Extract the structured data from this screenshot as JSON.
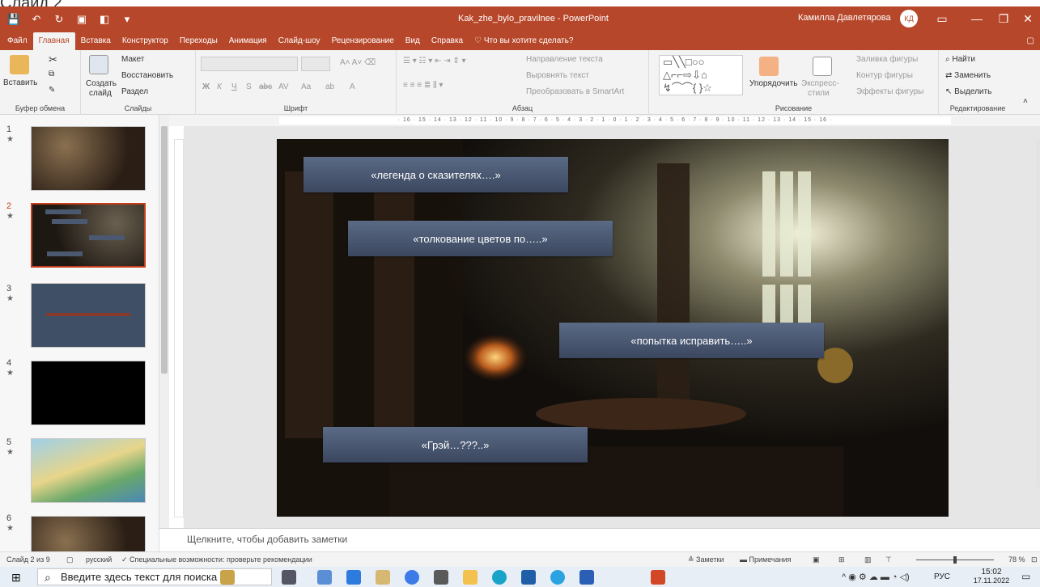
{
  "overlay_heading": "Слайд 2",
  "titlebar": {
    "doc_title": "Kak_zhe_bylo_pravilnee  -  PowerPoint",
    "user_name": "Камилла Давлетярова",
    "user_initials": "КД"
  },
  "tabs": [
    "Файл",
    "Главная",
    "Вставка",
    "Конструктор",
    "Переходы",
    "Анимация",
    "Слайд-шоу",
    "Рецензирование",
    "Вид",
    "Справка"
  ],
  "tell_me": "Что вы хотите сделать?",
  "ribbon": {
    "clipboard": {
      "paste": "Вставить",
      "label": "Буфер обмена"
    },
    "slides": {
      "layout": "Макет",
      "reset": "Восстановить",
      "new_slide_1": "Создать",
      "new_slide_2": "слайд",
      "section": "Раздел",
      "label": "Слайды"
    },
    "font": {
      "label": "Шрифт",
      "bold": "Ж",
      "italic": "К",
      "underline": "Ч",
      "shadow": "S",
      "strike": "abc",
      "spacing": "AV",
      "case": "Aa",
      "color": "A"
    },
    "paragraph": {
      "text_direction": "Направление текста",
      "align_text": "Выровнять текст",
      "smartart": "Преобразовать в SmartArt",
      "label": "Абзац"
    },
    "drawing": {
      "arrange": "Упорядочить",
      "quick_styles_1": "Экспресс-",
      "quick_styles_2": "стили",
      "fill": "Заливка фигуры",
      "outline": "Контур фигуры",
      "effects": "Эффекты фигуры",
      "label": "Рисование"
    },
    "editing": {
      "find": "Найти",
      "replace": "Заменить",
      "select": "Выделить",
      "label": "Редактирование"
    }
  },
  "thumbnails": [
    {
      "num": "1",
      "star": "★"
    },
    {
      "num": "2",
      "star": "★"
    },
    {
      "num": "3",
      "star": "★"
    },
    {
      "num": "4",
      "star": "★"
    },
    {
      "num": "5",
      "star": "★"
    },
    {
      "num": "6",
      "star": "★"
    }
  ],
  "ruler_h": "· 16 · 15 · 14 · 13 · 12 · 11 · 10 · 9 · 8 · 7 · 6 · 5 · 4 · 3 · 2 · 1 · 0 · 1 · 2 · 3 · 4 · 5 · 6 · 7 · 8 · 9 · 10 · 11 · 12 · 13 · 14 · 15 · 16 ·",
  "slide": {
    "boxes": [
      {
        "text": "«легенда о сказителях….»"
      },
      {
        "text": "«толкование цветов по…..»"
      },
      {
        "text": "«попытка исправить…..»"
      },
      {
        "text": "«Грэй…???..»"
      }
    ]
  },
  "notes_placeholder": "Щелкните, чтобы добавить заметки",
  "status": {
    "slide_of": "Слайд 2 из 9",
    "language": "русский",
    "accessibility": "Специальные возможности: проверьте рекомендации",
    "notes_btn": "Заметки",
    "comments_btn": "Примечания",
    "zoom": "78 %"
  },
  "taskbar": {
    "search_placeholder": "Введите здесь текст для поиска",
    "lang": "РУС",
    "time": "15:02",
    "date": "17.11.2022"
  }
}
